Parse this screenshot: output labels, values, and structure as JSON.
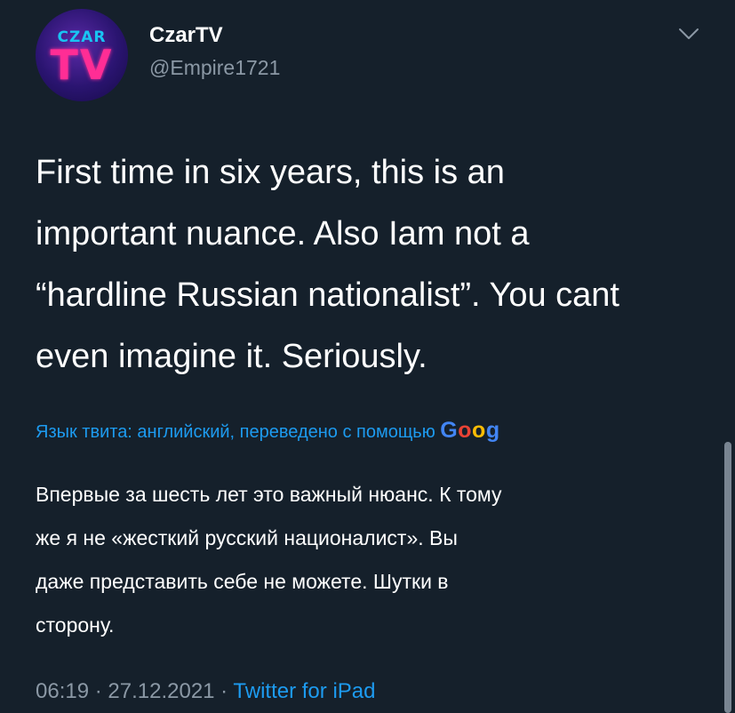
{
  "author": {
    "avatar_logo_top": "CZAR",
    "avatar_logo_bottom": "TV",
    "display_name": "CzarTV",
    "handle": "@Empire1721"
  },
  "tweet": {
    "text_lines": [
      "First time in six years, this is an",
      "important nuance. Also Iam not a",
      "“hardline Russian nationalist”. You cant",
      "even imagine it. Seriously."
    ]
  },
  "translation": {
    "note": "Язык твита: английский, переведено с помощью ",
    "google_letters": [
      "G",
      "o",
      "o",
      "g"
    ],
    "google_colors": [
      "#4285f4",
      "#ea4335",
      "#fbbc05",
      "#4285f4"
    ],
    "lines": [
      "Впервые за шесть лет это важный нюанс. К тому",
      "же я не «жесткий русский националист». Вы",
      "даже представить себе не можете. Шутки в",
      "сторону."
    ]
  },
  "meta": {
    "time": "06:19",
    "separator": " · ",
    "date": "27.12.2021",
    "source": "Twitter for iPad"
  },
  "icons": {
    "more": "chevron-down-icon"
  },
  "colors": {
    "background": "#15202b",
    "accent": "#1d9bf0",
    "secondary_text": "#8b98a5"
  }
}
